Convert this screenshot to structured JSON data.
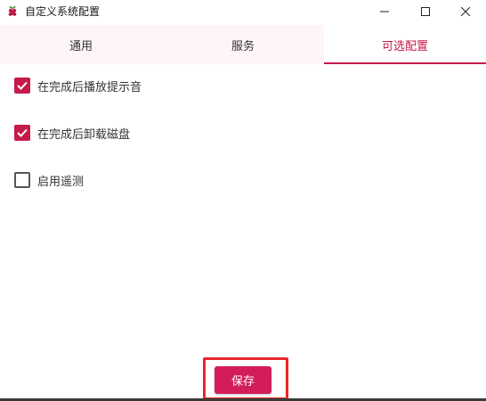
{
  "window": {
    "title": "自定义系统配置",
    "icon": "raspberry-pi-icon"
  },
  "tabs": [
    {
      "label": "通用",
      "active": false
    },
    {
      "label": "服务",
      "active": false
    },
    {
      "label": "可选配置",
      "active": true
    }
  ],
  "options": [
    {
      "label": "在完成后播放提示音",
      "checked": true
    },
    {
      "label": "在完成后卸载磁盘",
      "checked": true
    },
    {
      "label": "启用遥测",
      "checked": false
    }
  ],
  "save_label": "保存",
  "colors": {
    "accent": "#c51a4a",
    "button": "#d31c5b",
    "highlight_box": "#e8262a"
  }
}
